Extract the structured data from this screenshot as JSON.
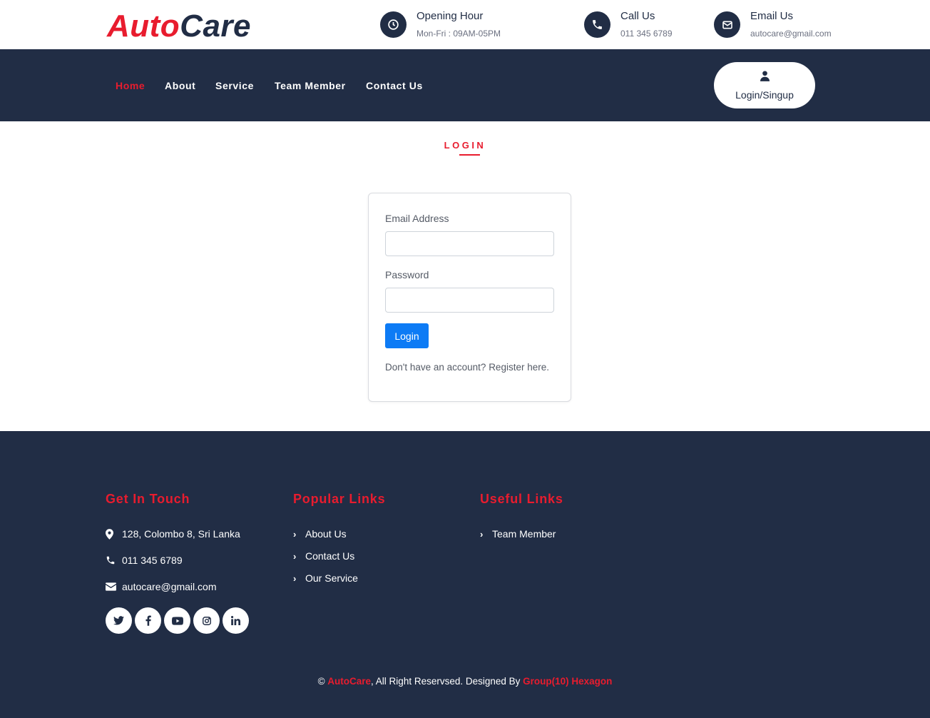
{
  "brand": {
    "part1": "Auto",
    "part2": "Care"
  },
  "top_info": {
    "hours": {
      "title": "Opening Hour",
      "value": "Mon-Fri : 09AM-05PM",
      "icon": "clock-icon"
    },
    "call": {
      "title": "Call Us",
      "value": "011 345 6789",
      "icon": "phone-icon"
    },
    "email": {
      "title": "Email Us",
      "value": "autocare@gmail.com",
      "icon": "envelope-icon"
    }
  },
  "nav": {
    "items": [
      {
        "label": "Home",
        "active": true
      },
      {
        "label": "About"
      },
      {
        "label": "Service"
      },
      {
        "label": "Team Member"
      },
      {
        "label": "Contact Us"
      }
    ],
    "login_button": "Login/Singup"
  },
  "login": {
    "heading": "LOGIN",
    "email_label": "Email Address",
    "email_value": "",
    "password_label": "Password",
    "password_value": "",
    "submit_label": "Login",
    "register_prompt": "Don't have an account? ",
    "register_link": "Register here."
  },
  "footer": {
    "get_in_touch": {
      "title": "Get In Touch",
      "address": "128, Colombo 8, Sri Lanka",
      "phone": "011 345 6789",
      "email": "autocare@gmail.com"
    },
    "popular_links": {
      "title": "Popular Links",
      "items": [
        "About Us",
        "Contact Us",
        "Our Service"
      ]
    },
    "useful_links": {
      "title": "Useful Links",
      "items": [
        "Team Member"
      ]
    },
    "socials": [
      "twitter-icon",
      "facebook-icon",
      "youtube-icon",
      "instagram-icon",
      "linkedin-icon"
    ],
    "copyright": {
      "symbol": "©",
      "brand": "AutoCare",
      "middle": ", All Right Reservsed. Designed By ",
      "designer": "Group(10) Hexagon"
    }
  },
  "colors": {
    "navy": "#212d45",
    "brand_red": "#e81c2e",
    "primary_blue": "#0d7bf5"
  }
}
